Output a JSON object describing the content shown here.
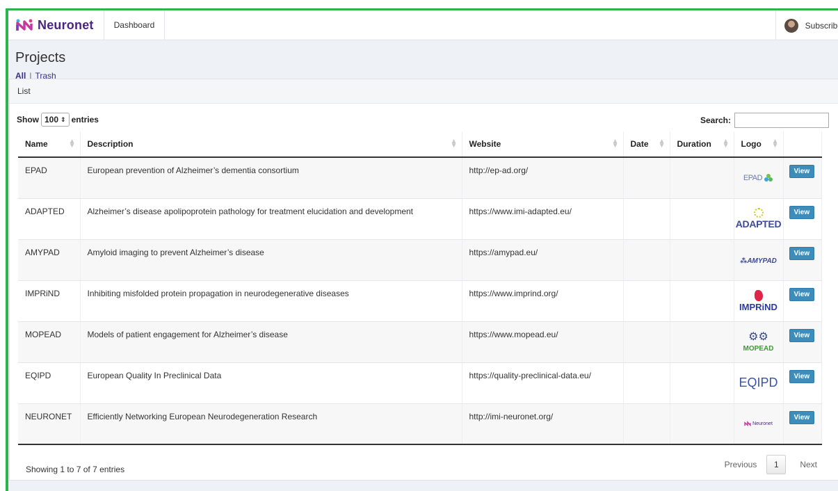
{
  "navbar": {
    "brand": "Neuronet",
    "dashboard_label": "Dashboard",
    "user_label": "Subscriber"
  },
  "header": {
    "title": "Projects",
    "filter_all": "All",
    "filter_separator": "|",
    "filter_trash": "Trash"
  },
  "card": {
    "title": "List",
    "show_label": "Show",
    "entries_select_value": "100",
    "entries_label": "entries",
    "search_label": "Search:",
    "search_value": ""
  },
  "table": {
    "columns": [
      "Name",
      "Description",
      "Website",
      "Date",
      "Duration",
      "Logo"
    ],
    "rows": [
      {
        "name": "EPAD",
        "description": "European prevention of Alzheimer’s dementia consortium",
        "website": "http://ep-ad.org/",
        "date": "",
        "duration": "",
        "logo_text": "EPAD",
        "view": "View"
      },
      {
        "name": "ADAPTED",
        "description": "Alzheimer’s disease apolipoprotein pathology for treatment elucidation and development",
        "website": "https://www.imi-adapted.eu/",
        "date": "",
        "duration": "",
        "logo_text": "ADAPTED",
        "view": "View"
      },
      {
        "name": "AMYPAD",
        "description": "Amyloid imaging to prevent Alzheimer’s disease",
        "website": "https://amypad.eu/",
        "date": "",
        "duration": "",
        "logo_text": "AMYPAD",
        "view": "View"
      },
      {
        "name": "IMPRiND",
        "description": "Inhibiting misfolded protein propagation in neurodegenerative diseases",
        "website": "https://www.imprind.org/",
        "date": "",
        "duration": "",
        "logo_text": "IMPRiND",
        "view": "View"
      },
      {
        "name": "MOPEAD",
        "description": "Models of patient engagement for Alzheimer’s disease",
        "website": "https://www.mopead.eu/",
        "date": "",
        "duration": "",
        "logo_text": "MOPEAD",
        "view": "View"
      },
      {
        "name": "EQIPD",
        "description": "European Quality In Preclinical Data",
        "website": "https://quality-preclinical-data.eu/",
        "date": "",
        "duration": "",
        "logo_text": "EQIPD",
        "view": "View"
      },
      {
        "name": "NEURONET",
        "description": "Efficiently Networking European Neurodegeneration Research",
        "website": "http://imi-neuronet.org/",
        "date": "",
        "duration": "",
        "logo_text": "Neuronet",
        "view": "View"
      }
    ]
  },
  "footer": {
    "info": "Showing 1 to 7 of 7 entries",
    "previous": "Previous",
    "current_page": "1",
    "next": "Next"
  },
  "colors": {
    "frame_green": "#2fb34a",
    "brand_purple": "#4a2680",
    "view_button": "#3c8dbc"
  },
  "icons": {
    "brand_logo": "neuronet-logo-icon",
    "avatar": "user-avatar",
    "sort": "sort-arrows-icon"
  }
}
